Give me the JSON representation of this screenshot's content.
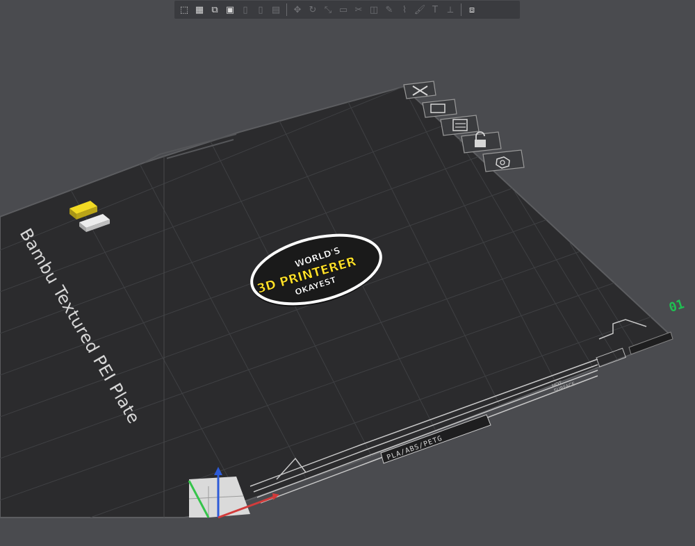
{
  "window": {
    "title": ""
  },
  "toolbar": {
    "groups": [
      [
        {
          "name": "add-cube-icon",
          "glyph": "⬚",
          "enabled": true
        },
        {
          "name": "arrange-grid-icon",
          "glyph": "▦",
          "enabled": true
        },
        {
          "name": "auto-orient-icon",
          "glyph": "⧉",
          "enabled": true
        },
        {
          "name": "plate-icon",
          "glyph": "▣",
          "enabled": true
        },
        {
          "name": "split-objects-icon",
          "glyph": "▯",
          "enabled": false
        },
        {
          "name": "split-parts-icon",
          "glyph": "▯",
          "enabled": false
        },
        {
          "name": "layers-icon",
          "glyph": "▤",
          "enabled": false
        }
      ],
      [
        {
          "name": "move-icon",
          "glyph": "✥",
          "enabled": false
        },
        {
          "name": "rotate-icon",
          "glyph": "↻",
          "enabled": false
        },
        {
          "name": "scale-icon",
          "glyph": "⤡",
          "enabled": false
        },
        {
          "name": "lay-on-face-icon",
          "glyph": "▭",
          "enabled": false
        },
        {
          "name": "cut-icon",
          "glyph": "✂",
          "enabled": false
        },
        {
          "name": "mesh-boolean-icon",
          "glyph": "◫",
          "enabled": false
        },
        {
          "name": "support-paint-icon",
          "glyph": "✎",
          "enabled": false
        },
        {
          "name": "seam-paint-icon",
          "glyph": "⌇",
          "enabled": false
        },
        {
          "name": "color-paint-icon",
          "glyph": "🖌",
          "enabled": false
        },
        {
          "name": "text-icon",
          "glyph": "T",
          "enabled": false
        },
        {
          "name": "measure-icon",
          "glyph": "⟂",
          "enabled": false
        }
      ],
      [
        {
          "name": "assembly-view-icon",
          "glyph": "⧈",
          "enabled": true
        }
      ]
    ]
  },
  "plate": {
    "label": "Bambu Textured PEI Plate",
    "number": "01",
    "footer_label": "PLA/ABS/PETG",
    "surface_label_1": "HOT",
    "surface_label_2": "SURFACE"
  },
  "plate_tools": [
    {
      "name": "remove-plate-icon",
      "glyph": "✕"
    },
    {
      "name": "arrange-plate-icon",
      "glyph": "⧉"
    },
    {
      "name": "plate-settings-icon",
      "glyph": "▤"
    },
    {
      "name": "lock-plate-icon",
      "glyph": "🔓"
    },
    {
      "name": "plate-gear-icon",
      "glyph": "⚙"
    }
  ],
  "model": {
    "line1": "WORLD'S",
    "line2": "3D PRINTERER",
    "line3": "OKAYEST"
  },
  "colors": {
    "background": "#4a4b4f",
    "plate": "#2b2b2d",
    "grid_line": "#3f4043",
    "plate_edge": "#5c5d60",
    "label_text": "#d8d8d8",
    "model_dark": "#1a1a1a",
    "model_white": "#ffffff",
    "model_yellow": "#ffe02a",
    "axis_x": "#d23b3b",
    "axis_y": "#35c44a",
    "axis_z": "#2d5bd8",
    "plate_number": "#1fbf52"
  }
}
